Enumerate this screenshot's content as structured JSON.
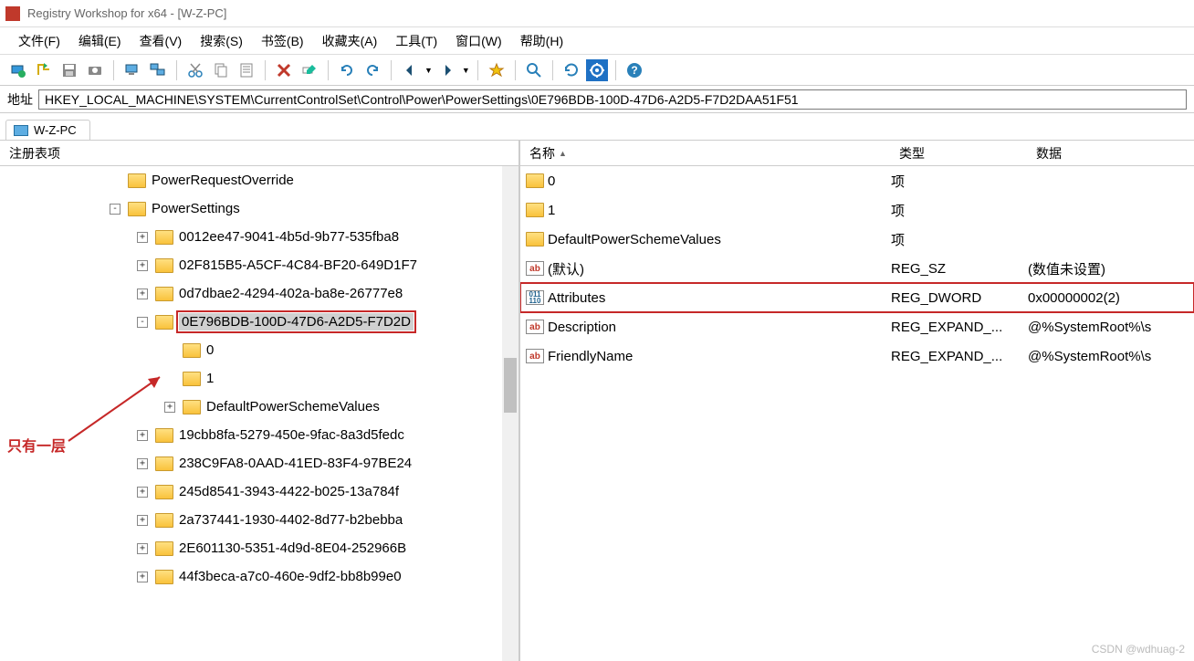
{
  "window": {
    "title": "Registry Workshop for x64 - [W-Z-PC]"
  },
  "menu": {
    "file": "文件(F)",
    "edit": "编辑(E)",
    "view": "查看(V)",
    "search": "搜索(S)",
    "bookmarks": "书签(B)",
    "favorites": "收藏夹(A)",
    "tools": "工具(T)",
    "window": "窗口(W)",
    "help": "帮助(H)"
  },
  "address": {
    "label": "地址",
    "value": "HKEY_LOCAL_MACHINE\\SYSTEM\\CurrentControlSet\\Control\\Power\\PowerSettings\\0E796BDB-100D-47D6-A2D5-F7D2DAA51F51"
  },
  "tab": {
    "label": "W-Z-PC"
  },
  "leftHeader": "注册表项",
  "rightHeader": {
    "name": "名称",
    "type": "类型",
    "data": "数据"
  },
  "tree": [
    {
      "indent": 0,
      "tog": "",
      "label": "PowerRequestOverride"
    },
    {
      "indent": 0,
      "tog": "-",
      "label": "PowerSettings"
    },
    {
      "indent": 1,
      "tog": "+",
      "label": "0012ee47-9041-4b5d-9b77-535fba8"
    },
    {
      "indent": 1,
      "tog": "+",
      "label": "02F815B5-A5CF-4C84-BF20-649D1F7"
    },
    {
      "indent": 1,
      "tog": "+",
      "label": "0d7dbae2-4294-402a-ba8e-26777e8"
    },
    {
      "indent": 1,
      "tog": "-",
      "label": "0E796BDB-100D-47D6-A2D5-F7D2D",
      "selected": true
    },
    {
      "indent": 2,
      "tog": "",
      "label": "0"
    },
    {
      "indent": 2,
      "tog": "",
      "label": "1"
    },
    {
      "indent": 2,
      "tog": "+",
      "label": "DefaultPowerSchemeValues"
    },
    {
      "indent": 1,
      "tog": "+",
      "label": "19cbb8fa-5279-450e-9fac-8a3d5fedc"
    },
    {
      "indent": 1,
      "tog": "+",
      "label": "238C9FA8-0AAD-41ED-83F4-97BE24"
    },
    {
      "indent": 1,
      "tog": "+",
      "label": "245d8541-3943-4422-b025-13a784f"
    },
    {
      "indent": 1,
      "tog": "+",
      "label": "2a737441-1930-4402-8d77-b2bebba"
    },
    {
      "indent": 1,
      "tog": "+",
      "label": "2E601130-5351-4d9d-8E04-252966B"
    },
    {
      "indent": 1,
      "tog": "+",
      "label": "44f3beca-a7c0-460e-9df2-bb8b99e0"
    }
  ],
  "list": [
    {
      "icon": "folder",
      "name": "0",
      "type": "项",
      "data": ""
    },
    {
      "icon": "folder",
      "name": "1",
      "type": "项",
      "data": ""
    },
    {
      "icon": "folder",
      "name": "DefaultPowerSchemeValues",
      "type": "项",
      "data": ""
    },
    {
      "icon": "ab",
      "name": "(默认)",
      "type": "REG_SZ",
      "data": "(数值未设置)"
    },
    {
      "icon": "011",
      "name": "Attributes",
      "type": "REG_DWORD",
      "data": "0x00000002(2)",
      "highlight": true
    },
    {
      "icon": "ab",
      "name": "Description",
      "type": "REG_EXPAND_...",
      "data": "@%SystemRoot%\\s"
    },
    {
      "icon": "ab",
      "name": "FriendlyName",
      "type": "REG_EXPAND_...",
      "data": "@%SystemRoot%\\s"
    }
  ],
  "annotation": "只有一层",
  "watermark": "CSDN @wdhuag-2"
}
